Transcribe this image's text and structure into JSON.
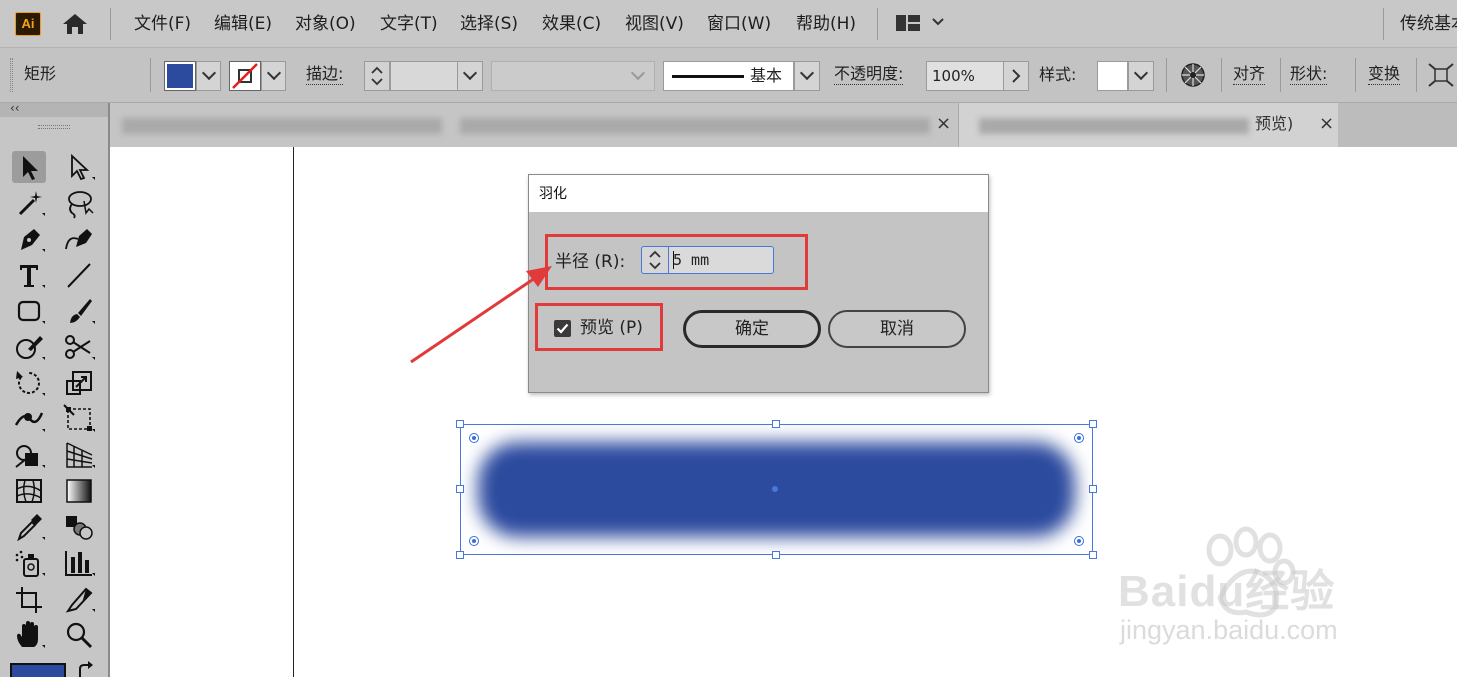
{
  "app": {
    "logo": "Ai",
    "workspace": "传统基本"
  },
  "menu": {
    "items": [
      "文件(F)",
      "编辑(E)",
      "对象(O)",
      "文字(T)",
      "选择(S)",
      "效果(C)",
      "视图(V)",
      "窗口(W)",
      "帮助(H)"
    ]
  },
  "control_bar": {
    "object_type": "矩形",
    "stroke_label": "描边",
    "stroke_style_label": "基本",
    "opacity_label": "不透明度",
    "opacity_value": "100%",
    "style_label": "样式",
    "align_label": "对齐",
    "shape_label": "形状",
    "transform_label": "变换",
    "colon": ":",
    "fill_color": "#2c4a9e"
  },
  "tabs": {
    "tab1_close": "×",
    "tab2_title": "预览)",
    "tab2_close": "×"
  },
  "toolbar": {
    "collapse": "‹‹",
    "tools": [
      "selection-tool",
      "direct-selection-tool",
      "magic-wand-tool",
      "lasso-tool",
      "pen-tool",
      "curvature-tool",
      "type-tool",
      "line-tool",
      "rectangle-tool",
      "paintbrush-tool",
      "shaper-tool",
      "scissors-tool",
      "rotate-tool",
      "scale-tool",
      "width-tool",
      "free-transform-tool",
      "shape-builder-tool",
      "perspective-grid-tool",
      "mesh-tool",
      "gradient-tool",
      "eyedropper-tool",
      "blend-tool",
      "symbol-sprayer-tool",
      "column-graph-tool",
      "artboard-tool",
      "slice-tool",
      "hand-tool",
      "zoom-tool"
    ]
  },
  "dialog": {
    "title": "羽化",
    "radius_label": "半径 (R):",
    "radius_value": "5 mm",
    "preview_label": "预览 (P)",
    "preview_checked": true,
    "ok_label": "确定",
    "cancel_label": "取消"
  },
  "artwork": {
    "fill_color": "#2c4a9e",
    "feathered": true
  },
  "annotation": {
    "color": "#e03a3a"
  },
  "watermark": {
    "brand": "Baidu经验",
    "url": "jingyan.baidu.com"
  }
}
